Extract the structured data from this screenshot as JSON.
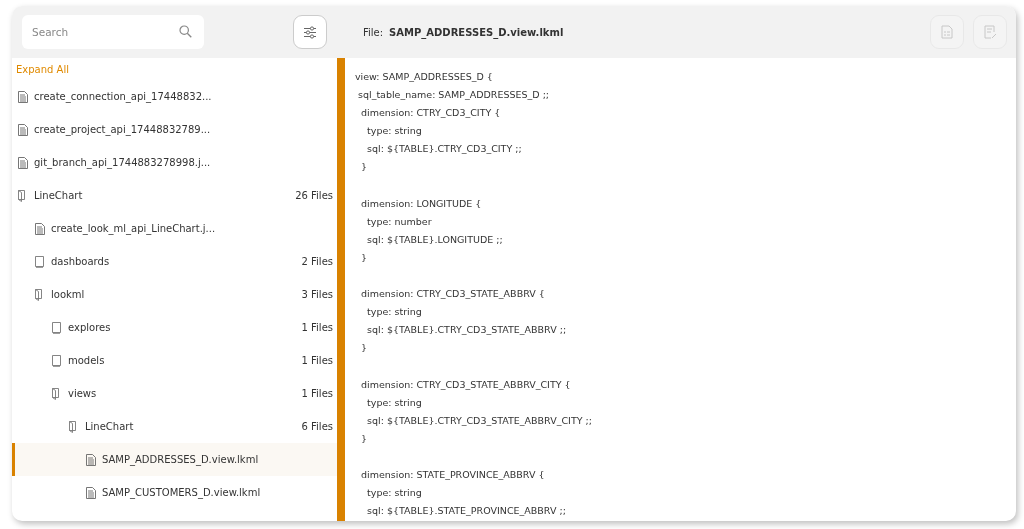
{
  "search": {
    "placeholder": "Search"
  },
  "header": {
    "file_label": "File:",
    "file_name": "SAMP_ADDRESSES_D.view.lkml",
    "actions": [
      {
        "kind": "details",
        "disabled": true
      },
      {
        "kind": "edit",
        "disabled": true
      }
    ]
  },
  "expand_all": "Expand All",
  "tree": [
    {
      "kind": "file",
      "label": "create_connection_api_17448832...",
      "selected": false
    },
    {
      "kind": "file",
      "label": "create_project_api_17448832789...",
      "selected": false
    },
    {
      "kind": "file",
      "label": "git_branch_api_1744883278998.j...",
      "selected": false
    },
    {
      "kind": "folder",
      "label": "LineChart",
      "count": "26 Files",
      "expanded": true,
      "children": [
        {
          "kind": "file",
          "label": "create_look_ml_api_LineChart.j...",
          "selected": false
        },
        {
          "kind": "folder",
          "label": "dashboards",
          "count": "2 Files",
          "expanded": false
        },
        {
          "kind": "folder",
          "label": "lookml",
          "count": "3 Files",
          "expanded": true,
          "children": [
            {
              "kind": "folder",
              "label": "explores",
              "count": "1 Files",
              "expanded": false
            },
            {
              "kind": "folder",
              "label": "models",
              "count": "1 Files",
              "expanded": false
            },
            {
              "kind": "folder",
              "label": "views",
              "count": "1 Files",
              "expanded": true,
              "children": [
                {
                  "kind": "folder",
                  "label": "LineChart",
                  "count": "6 Files",
                  "expanded": true,
                  "children": [
                    {
                      "kind": "file",
                      "label": "SAMP_ADDRESSES_D.view.lkml",
                      "selected": true
                    },
                    {
                      "kind": "file",
                      "label": "SAMP_CUSTOMERS_D.view.lkml",
                      "selected": false
                    }
                  ]
                }
              ]
            }
          ]
        }
      ]
    }
  ],
  "code_blocks": [
    {
      "lines": [
        "view: SAMP_ADDRESSES_D {",
        " sql_table_name: SAMP_ADDRESSES_D ;;",
        "  dimension: CTRY_CD3_CITY {",
        "    type: string",
        "    sql: ${TABLE}.CTRY_CD3_CITY ;;",
        "  }"
      ]
    },
    {
      "lines": [
        "  dimension: LONGITUDE {",
        "    type: number",
        "    sql: ${TABLE}.LONGITUDE ;;",
        "  }"
      ]
    },
    {
      "lines": [
        "  dimension: CTRY_CD3_STATE_ABBRV {",
        "    type: string",
        "    sql: ${TABLE}.CTRY_CD3_STATE_ABBRV ;;",
        "  }"
      ]
    },
    {
      "lines": [
        "  dimension: CTRY_CD3_STATE_ABBRV_CITY {",
        "    type: string",
        "    sql: ${TABLE}.CTRY_CD3_STATE_ABBRV_CITY ;;",
        "  }"
      ]
    },
    {
      "lines": [
        "  dimension: STATE_PROVINCE_ABBRV {",
        "    type: string",
        "    sql: ${TABLE}.STATE_PROVINCE_ABBRV ;;"
      ]
    }
  ]
}
